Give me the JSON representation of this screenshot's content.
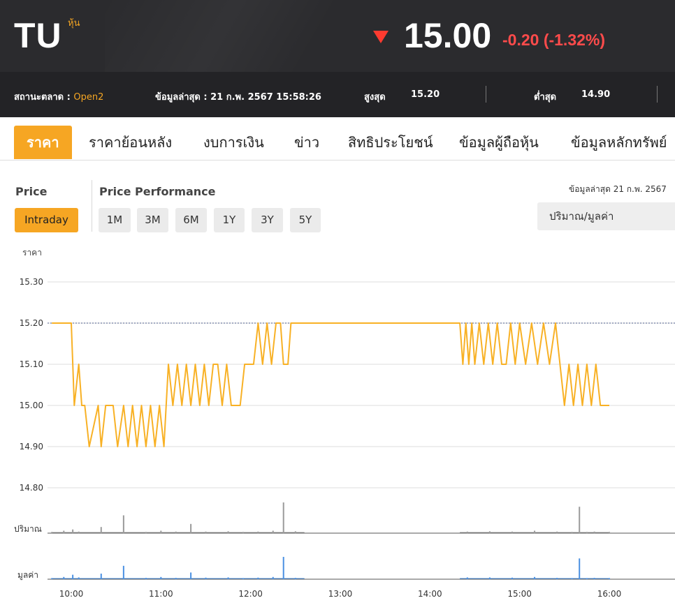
{
  "header": {
    "symbol": "TU",
    "symbol_type": "หุ้น",
    "price": "15.00",
    "change": "-0.20 (-1.32%)",
    "direction_icon": "triangle-down-icon",
    "colors": {
      "down": "#ff3b30",
      "accent": "#f6a623"
    }
  },
  "info": {
    "market_status_label": "สถานะตลาด :",
    "market_status_value": "Open2",
    "last_update": "ข้อมูลล่าสุด : 21 ก.พ. 2567 15:58:26",
    "high_label": "สูงสุด",
    "high_value": "15.20",
    "low_label": "ต่ำสุด",
    "low_value": "14.90"
  },
  "tabs": [
    "ราคา",
    "ราคาย้อนหลัง",
    "งบการเงิน",
    "ข่าว",
    "สิทธิประโยชน์",
    "ข้อมูลผู้ถือหุ้น",
    "ข้อมูลหลักทรัพย์"
  ],
  "controls": {
    "price_label": "Price",
    "intraday": "Intraday",
    "performance_label": "Price Performance",
    "periods": [
      "1M",
      "3M",
      "6M",
      "1Y",
      "3Y",
      "5Y"
    ],
    "updated": "ข้อมูลล่าสุด 21 ก.พ. 2567",
    "select_value": "ปริมาณ/มูลค่า"
  },
  "chart_data": {
    "type": "line",
    "ylabel": "ราคา",
    "y_ticks": [
      "15.30",
      "15.20",
      "15.10",
      "15.00",
      "14.90",
      "14.80"
    ],
    "ylim": [
      14.8,
      15.3
    ],
    "reference_line": 15.2,
    "x_ticks": [
      "10:00",
      "11:00",
      "12:00",
      "13:00",
      "14:00",
      "15:00",
      "16:00"
    ],
    "volume_label": "ปริมาณ",
    "value_label": "มูลค่า",
    "series": [
      {
        "color": "#f8b125",
        "x": [
          "09:47",
          "10:00",
          "10:02",
          "10:05",
          "10:07",
          "10:09",
          "10:12",
          "10:18",
          "10:20",
          "10:23",
          "10:28",
          "10:31",
          "10:35",
          "10:38",
          "10:41",
          "10:44",
          "10:47",
          "10:50",
          "10:53",
          "10:56",
          "10:59",
          "11:02",
          "11:05",
          "11:08",
          "11:11",
          "11:14",
          "11:17",
          "11:20",
          "11:23",
          "11:26",
          "11:29",
          "11:32",
          "11:35",
          "11:38",
          "11:41",
          "11:44",
          "11:47",
          "11:50",
          "11:53",
          "11:56",
          "11:59",
          "12:02",
          "12:05",
          "12:08",
          "12:11",
          "12:14",
          "12:17",
          "12:20",
          "12:22",
          "12:25",
          "12:27",
          "12:29",
          "12:31",
          "12:34",
          "12:36",
          "14:20",
          "14:22",
          "14:24",
          "14:26",
          "14:28",
          "14:30",
          "14:33",
          "14:36",
          "14:39",
          "14:42",
          "14:45",
          "14:48",
          "14:51",
          "14:54",
          "14:57",
          "15:00",
          "15:04",
          "15:08",
          "15:12",
          "15:16",
          "15:20",
          "15:24",
          "15:27",
          "15:30",
          "15:33",
          "15:36",
          "15:39",
          "15:42",
          "15:45",
          "15:48",
          "15:51",
          "15:54",
          "15:57",
          "16:00"
        ],
        "y": [
          15.2,
          15.2,
          15.0,
          15.1,
          15.0,
          15.0,
          14.9,
          15.0,
          14.9,
          15.0,
          15.0,
          14.9,
          15.0,
          14.9,
          15.0,
          14.9,
          15.0,
          14.9,
          15.0,
          14.9,
          15.0,
          14.9,
          15.1,
          15.0,
          15.1,
          15.0,
          15.1,
          15.0,
          15.1,
          15.0,
          15.1,
          15.0,
          15.1,
          15.1,
          15.0,
          15.1,
          15.0,
          15.0,
          15.0,
          15.1,
          15.1,
          15.1,
          15.2,
          15.1,
          15.2,
          15.1,
          15.2,
          15.2,
          15.1,
          15.1,
          15.2,
          15.2,
          15.2,
          15.2,
          15.2,
          15.2,
          15.1,
          15.2,
          15.1,
          15.2,
          15.1,
          15.2,
          15.1,
          15.2,
          15.1,
          15.2,
          15.1,
          15.1,
          15.2,
          15.1,
          15.2,
          15.1,
          15.2,
          15.1,
          15.2,
          15.1,
          15.2,
          15.1,
          15.0,
          15.1,
          15.0,
          15.1,
          15.0,
          15.1,
          15.0,
          15.1,
          15.0,
          15.0,
          15.0
        ]
      }
    ],
    "volume": {
      "color": "#9a9a9a",
      "x": [
        "09:47",
        "09:55",
        "10:01",
        "10:05",
        "10:20",
        "10:35",
        "10:50",
        "11:00",
        "11:10",
        "11:20",
        "11:30",
        "11:45",
        "11:55",
        "12:05",
        "12:15",
        "12:22",
        "12:30",
        "14:25",
        "14:40",
        "14:55",
        "15:10",
        "15:25",
        "15:35",
        "15:40",
        "15:45",
        "15:50",
        "16:00"
      ],
      "v": [
        0.04,
        0.08,
        0.12,
        0.05,
        0.2,
        0.58,
        0.04,
        0.08,
        0.05,
        0.3,
        0.05,
        0.06,
        0.04,
        0.05,
        0.08,
        1.0,
        0.06,
        0.05,
        0.06,
        0.05,
        0.08,
        0.05,
        0.04,
        0.86,
        0.04,
        0.05,
        0.04
      ]
    },
    "value": {
      "color": "#4a90e2",
      "x": [
        "09:47",
        "09:55",
        "10:01",
        "10:05",
        "10:20",
        "10:35",
        "10:50",
        "11:00",
        "11:10",
        "11:20",
        "11:30",
        "11:45",
        "11:55",
        "12:05",
        "12:15",
        "12:22",
        "12:30",
        "14:25",
        "14:40",
        "14:55",
        "15:10",
        "15:25",
        "15:35",
        "15:40",
        "15:45",
        "15:50",
        "16:00"
      ],
      "v": [
        0.05,
        0.1,
        0.2,
        0.08,
        0.25,
        0.6,
        0.06,
        0.1,
        0.06,
        0.3,
        0.07,
        0.08,
        0.05,
        0.07,
        0.1,
        1.0,
        0.06,
        0.08,
        0.08,
        0.07,
        0.1,
        0.06,
        0.05,
        0.93,
        0.05,
        0.06,
        0.05
      ]
    }
  }
}
